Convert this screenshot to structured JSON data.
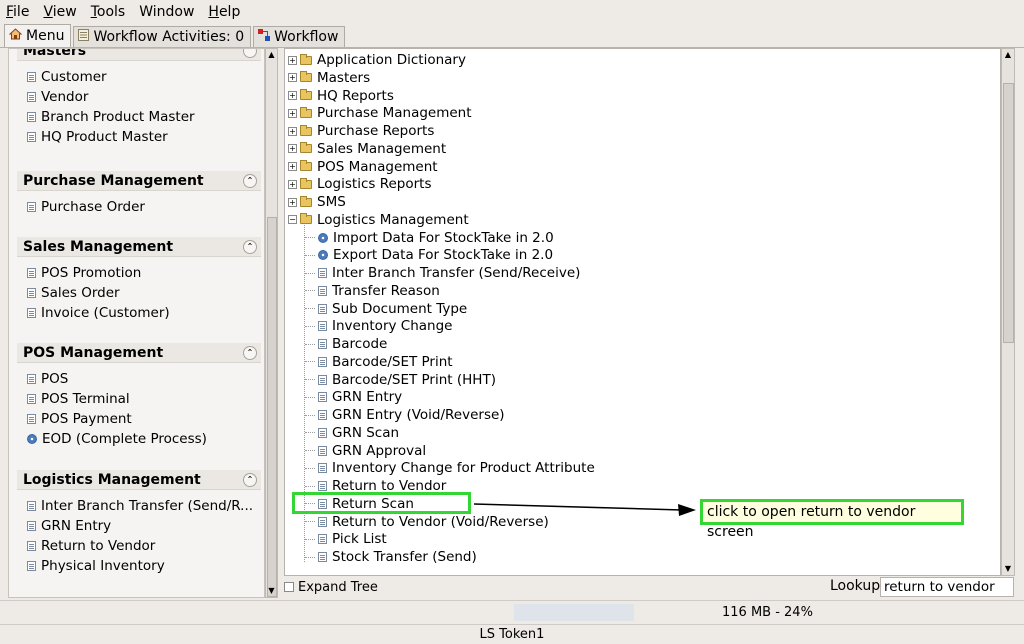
{
  "menubar": {
    "items": [
      "File",
      "View",
      "Tools",
      "Window",
      "Help"
    ],
    "accelerators": [
      "F",
      "V",
      "T",
      "",
      "H"
    ]
  },
  "tabs": [
    {
      "label": "Menu",
      "icon": "home-icon",
      "active": true
    },
    {
      "label": "Workflow Activities: 0",
      "icon": "clipboard-icon",
      "active": false
    },
    {
      "label": "Workflow",
      "icon": "workflow-icon",
      "active": false
    }
  ],
  "left_panel": {
    "sections": [
      {
        "title": "Masters",
        "items": [
          {
            "label": "Customer",
            "icon": "doc-icon"
          },
          {
            "label": "Vendor",
            "icon": "doc-icon"
          },
          {
            "label": "Branch Product Master",
            "icon": "doc-icon"
          },
          {
            "label": "HQ Product Master",
            "icon": "doc-icon"
          }
        ]
      },
      {
        "title": "Purchase Management",
        "items": [
          {
            "label": "Purchase Order",
            "icon": "doc-icon"
          }
        ]
      },
      {
        "title": "Sales Management",
        "items": [
          {
            "label": "POS Promotion",
            "icon": "doc-icon"
          },
          {
            "label": "Sales Order",
            "icon": "doc-icon"
          },
          {
            "label": "Invoice (Customer)",
            "icon": "doc-icon"
          }
        ]
      },
      {
        "title": "POS Management",
        "items": [
          {
            "label": "POS",
            "icon": "doc-icon"
          },
          {
            "label": "POS Terminal",
            "icon": "doc-icon"
          },
          {
            "label": "POS Payment",
            "icon": "doc-icon"
          },
          {
            "label": "EOD (Complete Process)",
            "icon": "gear-icon"
          }
        ]
      },
      {
        "title": "Logistics Management",
        "items": [
          {
            "label": "Inter Branch Transfer (Send/R...",
            "icon": "doc-icon"
          },
          {
            "label": "GRN Entry",
            "icon": "doc-icon"
          },
          {
            "label": "Return to Vendor",
            "icon": "doc-icon"
          },
          {
            "label": "Physical Inventory",
            "icon": "doc-icon"
          }
        ]
      }
    ]
  },
  "tree": {
    "folders": [
      "Application Dictionary",
      "Masters",
      "HQ Reports",
      "Purchase Management",
      "Purchase Reports",
      "Sales Management",
      "POS Management",
      "Logistics Reports",
      "SMS"
    ],
    "expanded_folder": "Logistics Management",
    "children": [
      {
        "label": "Import Data For StockTake in 2.0",
        "icon": "gear-icon"
      },
      {
        "label": "Export Data For StockTake in 2.0",
        "icon": "gear-icon"
      },
      {
        "label": "Inter Branch Transfer (Send/Receive)",
        "icon": "doc-icon"
      },
      {
        "label": "Transfer Reason",
        "icon": "doc-icon"
      },
      {
        "label": "Sub Document Type",
        "icon": "doc-icon"
      },
      {
        "label": "Inventory Change",
        "icon": "doc-icon"
      },
      {
        "label": "Barcode",
        "icon": "doc-icon"
      },
      {
        "label": "Barcode/SET Print",
        "icon": "doc-icon"
      },
      {
        "label": "Barcode/SET Print (HHT)",
        "icon": "doc-icon"
      },
      {
        "label": "GRN Entry",
        "icon": "doc-icon"
      },
      {
        "label": "GRN Entry (Void/Reverse)",
        "icon": "doc-icon"
      },
      {
        "label": "GRN Scan",
        "icon": "doc-icon"
      },
      {
        "label": "GRN Approval",
        "icon": "doc-icon"
      },
      {
        "label": "Inventory Change for Product Attribute",
        "icon": "doc-icon"
      },
      {
        "label": "Return to Vendor",
        "icon": "doc-icon"
      },
      {
        "label": "Return Scan",
        "icon": "doc-icon"
      },
      {
        "label": "Return to Vendor (Void/Reverse)",
        "icon": "doc-icon"
      },
      {
        "label": "Pick List",
        "icon": "doc-icon"
      },
      {
        "label": "Stock Transfer (Send)",
        "icon": "doc-icon"
      }
    ]
  },
  "bottom": {
    "expand_tree_label": "Expand Tree",
    "lookup_label": "Lookup",
    "lookup_value": "return to vendor"
  },
  "status": {
    "memory": "116 MB - 24%"
  },
  "footer": {
    "text": "LS Token1"
  },
  "annotation": {
    "callout_text": "click to open return to vendor screen",
    "color": "#33d633"
  }
}
